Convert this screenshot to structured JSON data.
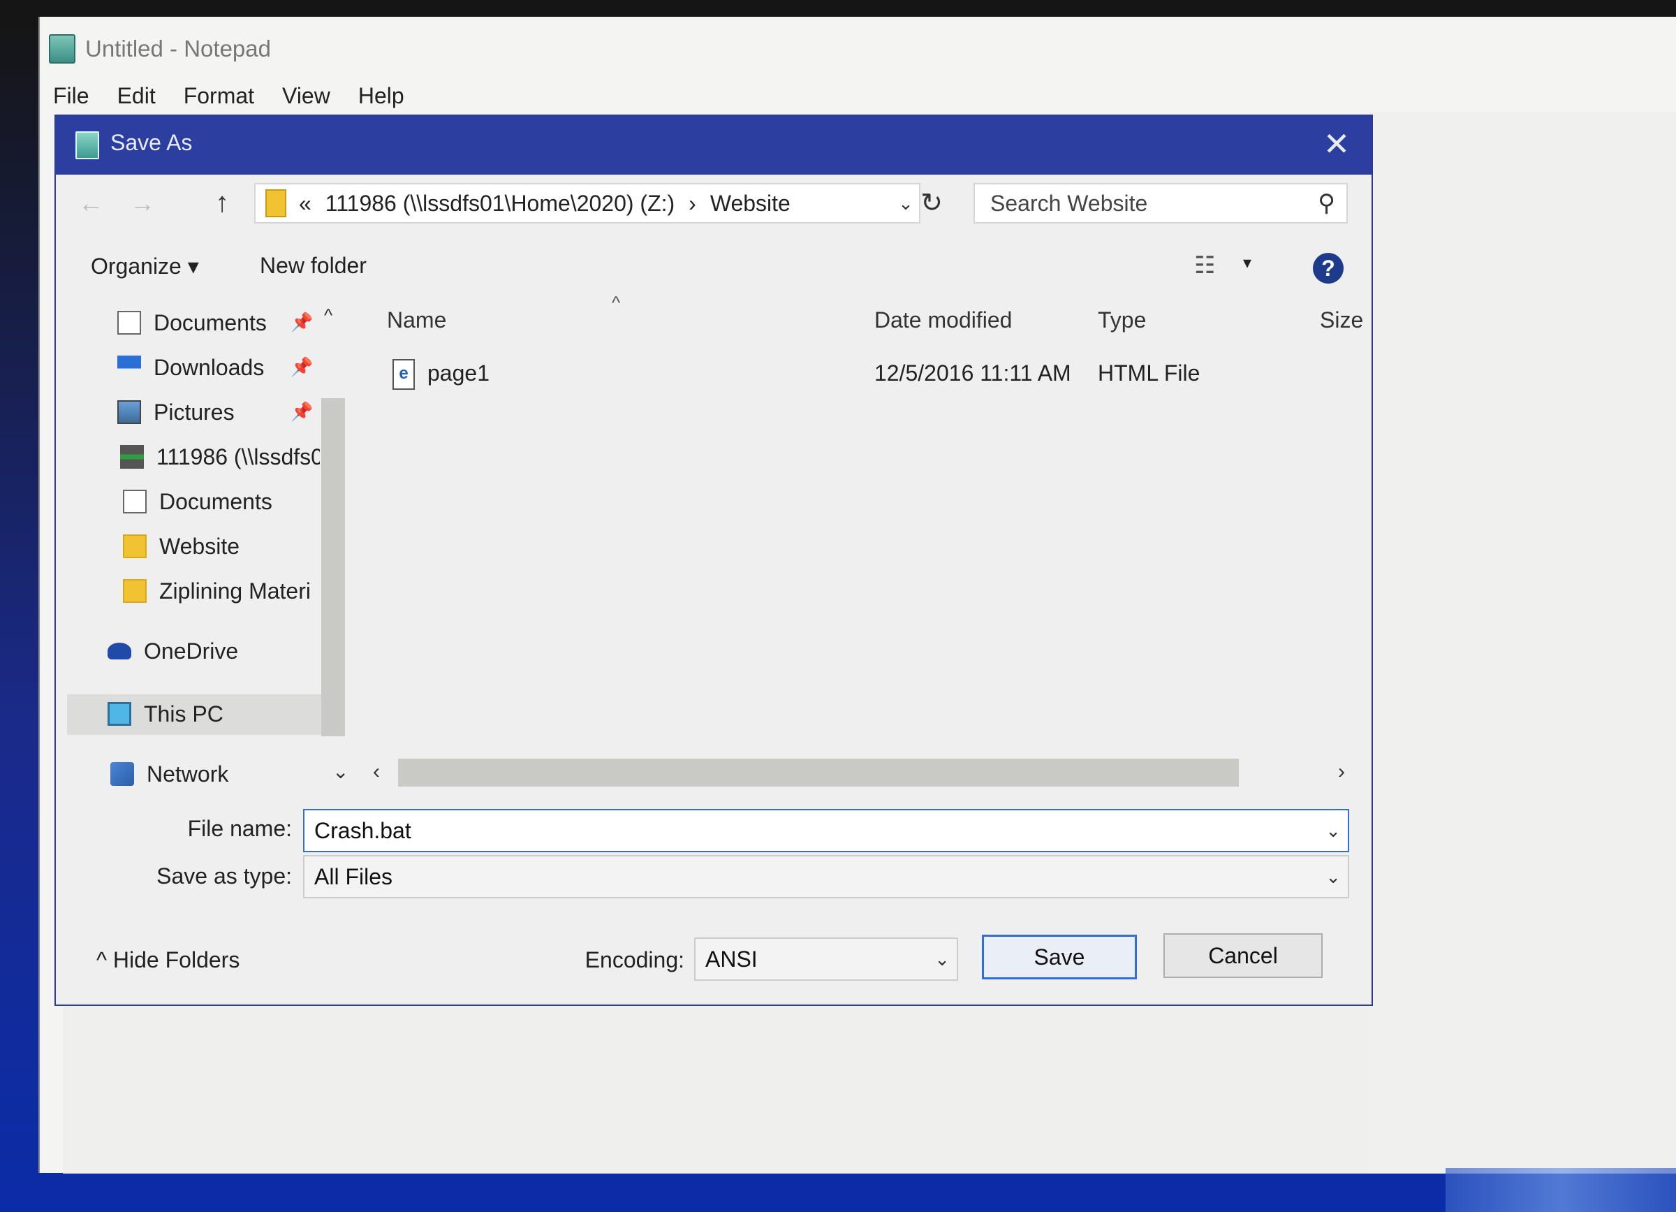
{
  "notepad": {
    "title": "Untitled - Notepad",
    "menu": [
      "File",
      "Edit",
      "Format",
      "View",
      "Help"
    ]
  },
  "dialog": {
    "title": "Save As",
    "close_glyph": "✕",
    "nav": {
      "back_glyph": "←",
      "forward_glyph": "→",
      "up_glyph": "↑",
      "address_prefix": "«",
      "address_drive": "111986 (\\\\lssdfs01\\Home\\2020) (Z:)",
      "address_sep": "›",
      "address_folder": "Website",
      "address_dropdown_glyph": "⌄",
      "refresh_glyph": "↻",
      "search_placeholder": "Search Website",
      "search_glyph": "⚲"
    },
    "toolbar": {
      "organize": "Organize ▾",
      "new_folder": "New folder",
      "view_glyph": "☷",
      "view_dd_glyph": "▾",
      "help_glyph": "?"
    },
    "sidebar": {
      "items": [
        {
          "label": "Documents",
          "icon": "documents-icon",
          "pinned": true
        },
        {
          "label": "Downloads",
          "icon": "download-icon",
          "pinned": true
        },
        {
          "label": "Pictures",
          "icon": "pictures-icon",
          "pinned": true
        },
        {
          "label": "111986 (\\\\lssdfs0",
          "icon": "network-drive-icon",
          "pinned": false
        },
        {
          "label": "Documents",
          "icon": "documents-icon",
          "pinned": false
        },
        {
          "label": "Website",
          "icon": "folder-icon",
          "pinned": false
        },
        {
          "label": "Ziplining Materi",
          "icon": "folder-icon",
          "pinned": false
        },
        {
          "label": "OneDrive",
          "icon": "onedrive-icon",
          "pinned": false
        },
        {
          "label": "This PC",
          "icon": "this-pc-icon",
          "pinned": false
        },
        {
          "label": "Network",
          "icon": "network-icon",
          "pinned": false
        }
      ],
      "pin_glyph": "📌",
      "scroll_up_glyph": "^",
      "scroll_down_glyph": "⌄"
    },
    "columns": {
      "sort_glyph": "^",
      "name": "Name",
      "date_modified": "Date modified",
      "type": "Type",
      "size": "Size"
    },
    "files": [
      {
        "icon_glyph": "e",
        "name": "page1",
        "date_modified": "12/5/2016 11:11 AM",
        "type": "HTML File",
        "size": ""
      }
    ],
    "hscroll": {
      "left_glyph": "‹",
      "right_glyph": "›"
    },
    "form": {
      "file_name_label": "File name:",
      "file_name_value": "Crash.bat",
      "save_as_type_label": "Save as type:",
      "save_as_type_value": "All Files",
      "dropdown_glyph": "⌄"
    },
    "footer": {
      "hide_folders": "^  Hide Folders",
      "encoding_label": "Encoding:",
      "encoding_value": "ANSI",
      "save": "Save",
      "cancel": "Cancel"
    }
  },
  "colors": {
    "dialog_title_bar": "#2c3ea0",
    "focus_border": "#2f6fd6",
    "folder": "#f1c232"
  }
}
